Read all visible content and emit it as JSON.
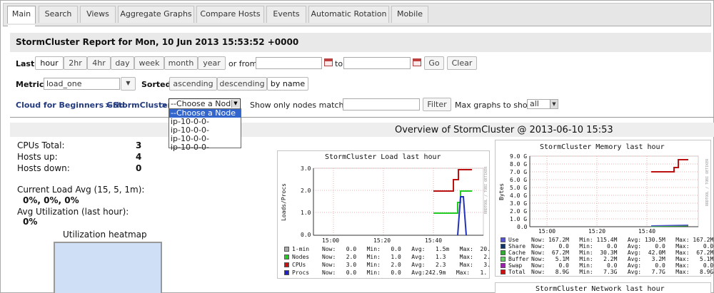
{
  "tabs": [
    "Main",
    "Search",
    "Views",
    "Aggregate Graphs",
    "Compare Hosts",
    "Events",
    "Automatic Rotation",
    "Mobile"
  ],
  "report_title": "StormCluster Report for Mon, 10 Jun 2013 15:53:52 +0000",
  "range": {
    "label": "Last",
    "buttons": [
      "hour",
      "2hr",
      "4hr",
      "day",
      "week",
      "month",
      "year"
    ],
    "selected": "hour",
    "or_from": "or from",
    "to": "to",
    "from_value": "",
    "to_value": "",
    "go": "Go",
    "clear": "Clear"
  },
  "metric": {
    "label": "Metric",
    "value": "load_one",
    "sorted_label": "Sorted",
    "sort_buttons": [
      "ascending",
      "descending",
      "by name"
    ],
    "selected_sort": "by name"
  },
  "breadcrumb": {
    "grid": "Cloud for Beginners Grid",
    "sep1": ">",
    "cluster": "StormCluster",
    "sep2": ">"
  },
  "node_select": {
    "selected": "--Choose a Node",
    "options": [
      "--Choose a Node",
      "ip-10-0-0-",
      "ip-10-0-0-",
      "ip-10-0-0-",
      "ip-10-0-0-"
    ]
  },
  "filter": {
    "label": "Show only nodes matching",
    "value": "",
    "button": "Filter",
    "max_label": "Max graphs to show",
    "max_value": "all"
  },
  "overview_title": "Overview of StormCluster @ 2013-06-10 15:53",
  "stats": {
    "cpus_label": "CPUs Total:",
    "cpus": "3",
    "hosts_up_label": "Hosts up:",
    "hosts_up": "4",
    "hosts_down_label": "Hosts down:",
    "hosts_down": "0",
    "load_label": "Current Load Avg (15, 5, 1m):",
    "load_value": "0%, 0%, 0%",
    "util_label": "Avg Utilization (last hour):",
    "util_value": "0%",
    "heatmap_label": "Utilization heatmap"
  },
  "load_graph": {
    "title": "StormCluster Load last hour",
    "ylabel": "Loads/Procs",
    "side_label": "RRDTOOL / TOBI OETIKER",
    "yticks": [
      "3.0",
      "2.0",
      "1.0",
      "0.0"
    ],
    "xticks": [
      "15:00",
      "15:20",
      "15:40"
    ],
    "legend": [
      {
        "name": "1-min",
        "color": "#aaaaaa",
        "line": "Now:   0.0   Min:   0.0   Avg:   1.5m   Max:  20."
      },
      {
        "name": "Nodes",
        "color": "#22cc22",
        "line": "Now:   2.0   Min:   1.0   Avg:   1.3    Max:   2."
      },
      {
        "name": "CPUs",
        "color": "#cc1111",
        "line": "Now:   3.0   Min:   2.0   Avg:   2.3    Max:   3."
      },
      {
        "name": "Procs",
        "color": "#2222cc",
        "line": "Now:   0.0   Min:   0.0   Avg:242.9m   Max:   1."
      }
    ]
  },
  "memory_graph": {
    "title": "StormCluster Memory last hour",
    "ylabel": "Bytes",
    "side_label": "RRDTOOL / TOBI OETIKER",
    "yticks": [
      "9.0 G",
      "8.0 G",
      "7.0 G",
      "6.0 G",
      "5.0 G",
      "4.0 G",
      "3.0 G",
      "2.0 G",
      "1.0 G",
      "0.0"
    ],
    "xticks": [
      "15:00",
      "15:20",
      "15:40"
    ],
    "legend": [
      {
        "name": "Use",
        "color": "#5555cc",
        "line": "Now: 167.2M   Min: 115.4M   Avg: 130.5M   Max: 167.2M"
      },
      {
        "name": "Share",
        "color": "#113366",
        "line": "Now:    0.0   Min:    0.0   Avg:    0.0   Max:    0.0"
      },
      {
        "name": "Cache",
        "color": "#33aa33",
        "line": "Now:  67.2M   Min:  30.3M   Avg:  42.0M   Max:  67.2M"
      },
      {
        "name": "Buffer",
        "color": "#66cc66",
        "line": "Now:   5.1M   Min:   2.2M   Avg:   3.2M   Max:   5.1M"
      },
      {
        "name": "Swap",
        "color": "#9922aa",
        "line": "Now:    0.0   Min:    0.0   Avg:    0.0   Max:    0.0"
      },
      {
        "name": "Total",
        "color": "#cc1111",
        "line": "Now:   8.9G   Min:   7.3G   Avg:   7.7G   Max:   8.9G"
      }
    ]
  },
  "network_graph": {
    "title": "StormCluster Network last hour"
  }
}
